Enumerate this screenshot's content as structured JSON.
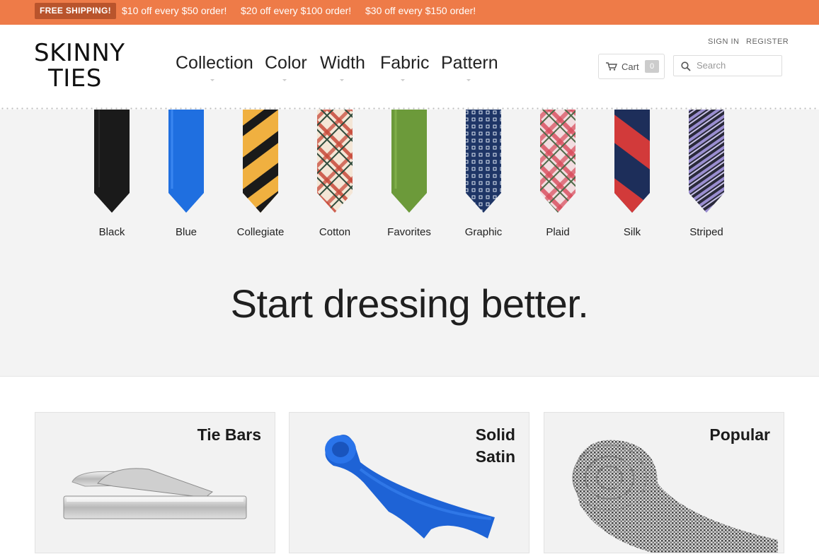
{
  "promo": {
    "badge": "FREE SHIPPING!",
    "offers": [
      "$10 off every $50 order!",
      "$20 off every $100 order!",
      "$30 off every $150 order!"
    ]
  },
  "header": {
    "logo_line1": "SKINNY",
    "logo_line2": "TIES",
    "nav": [
      "Collection",
      "Color",
      "Width",
      "Fabric",
      "Pattern"
    ],
    "sign_in": "SIGN IN",
    "register": "REGISTER",
    "cart_label": "Cart",
    "cart_count": "0",
    "search_placeholder": "Search"
  },
  "hero": {
    "categories": [
      "Black",
      "Blue",
      "Collegiate",
      "Cotton",
      "Favorites",
      "Graphic",
      "Plaid",
      "Silk",
      "Striped"
    ],
    "headline": "Start dressing better."
  },
  "cards": [
    {
      "title_line1": "Tie Bars",
      "title_line2": ""
    },
    {
      "title_line1": "Solid",
      "title_line2": "Satin"
    },
    {
      "title_line1": "Popular",
      "title_line2": ""
    }
  ],
  "colors": {
    "promo_bg": "#ee7b48",
    "promo_badge_bg": "#b9542c",
    "hero_bg": "#f3f3f3"
  }
}
